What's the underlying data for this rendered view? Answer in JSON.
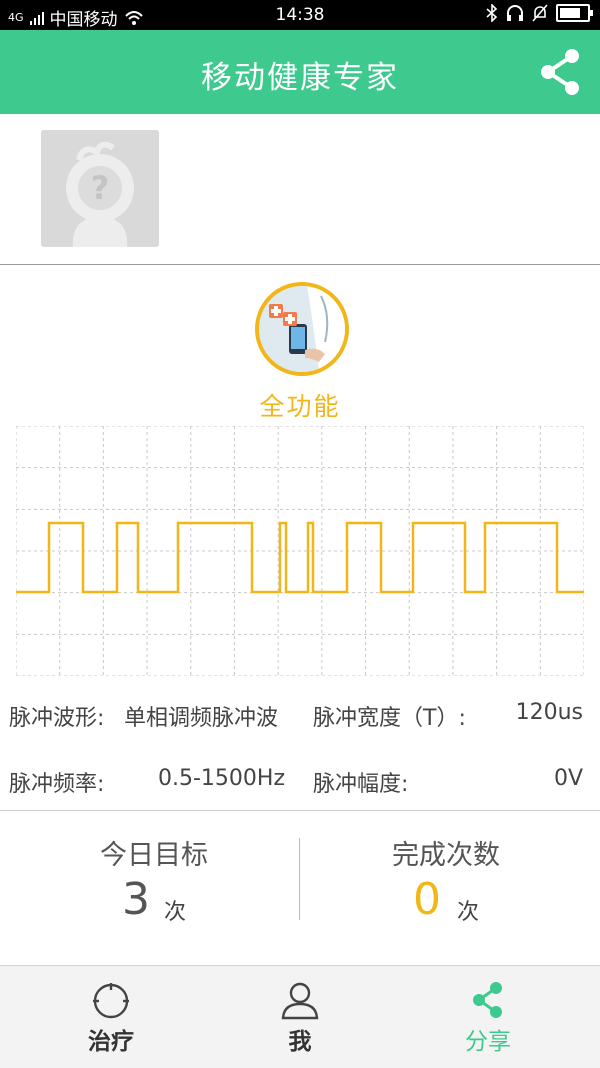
{
  "status_bar": {
    "carrier": "中国移动",
    "network": "4G",
    "time": "14:38"
  },
  "app_bar": {
    "title": "移动健康专家",
    "share_icon": "share-icon"
  },
  "profile": {
    "avatar_icon": "unknown-user-avatar"
  },
  "mode": {
    "label": "全功能",
    "icon": "doctor-phone-icon"
  },
  "waveform": {
    "pulse_levels": [
      0,
      1,
      0,
      1,
      0,
      1,
      0,
      1,
      0,
      1,
      0,
      1,
      0,
      1,
      0,
      1,
      0
    ],
    "colors": {
      "wave": "#f2b618",
      "grid": "#c8c8c8"
    }
  },
  "params": {
    "waveform_label": "脉冲波形:",
    "waveform_value": "单相调频脉冲波",
    "width_label": "脉冲宽度（T）:",
    "width_value": "120us",
    "frequency_label": "脉冲频率:",
    "frequency_value": "0.5-1500Hz",
    "amplitude_label": "脉冲幅度:",
    "amplitude_value": "0V"
  },
  "stats": {
    "goal_label": "今日目标",
    "goal_value": "3",
    "goal_unit": "次",
    "done_label": "完成次数",
    "done_value": "0",
    "done_unit": "次"
  },
  "tabs": [
    {
      "label": "治疗",
      "icon": "therapy-icon",
      "active": false
    },
    {
      "label": "我",
      "icon": "user-icon",
      "active": false
    },
    {
      "label": "分享",
      "icon": "share-icon",
      "active": true
    }
  ],
  "colors": {
    "primary": "#3ec98e",
    "accent": "#f2b618"
  }
}
